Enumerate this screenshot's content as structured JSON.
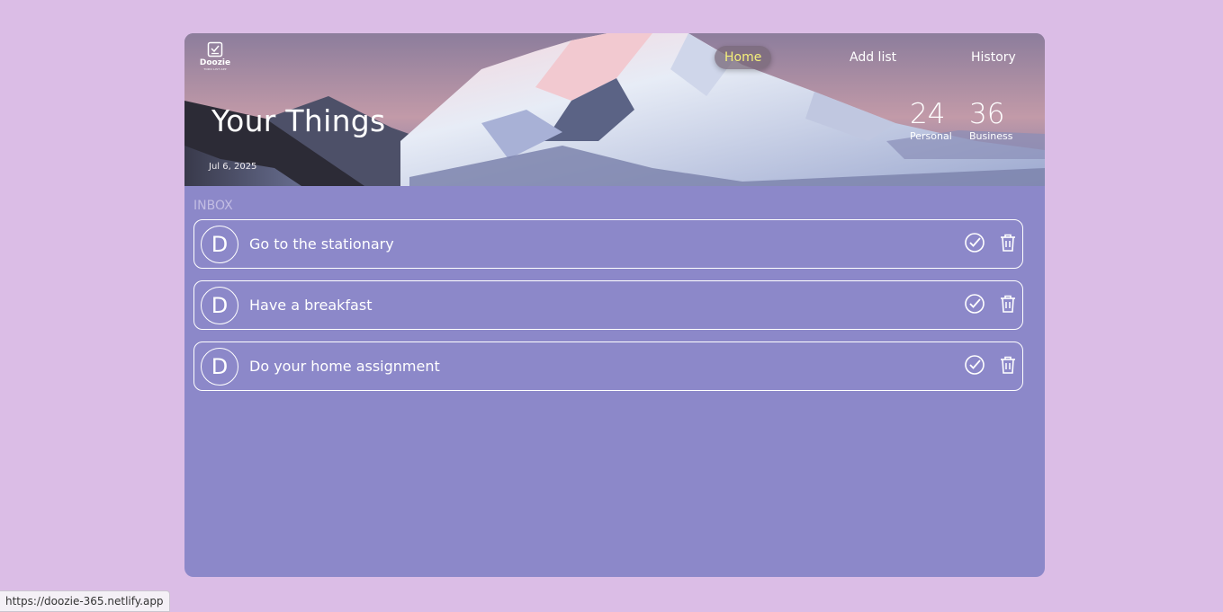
{
  "logo": {
    "name": "Doozie",
    "tagline": "TODO LIST APP"
  },
  "nav": {
    "items": [
      {
        "label": "Home",
        "active": true
      },
      {
        "label": "Add list",
        "active": false
      },
      {
        "label": "History",
        "active": false
      }
    ]
  },
  "hero": {
    "title": "Your Things",
    "date": "Jul 6, 2025"
  },
  "stats": [
    {
      "value": "24",
      "label": "Personal"
    },
    {
      "value": "36",
      "label": "Business"
    }
  ],
  "inbox": {
    "label": "INBOX",
    "tasks": [
      {
        "avatar": "D",
        "text": "Go to the stationary"
      },
      {
        "avatar": "D",
        "text": "Have a breakfast"
      },
      {
        "avatar": "D",
        "text": "Do your home assignment"
      }
    ]
  },
  "status_bar": {
    "url": "https://doozie-365.netlify.app"
  },
  "colors": {
    "page_background": "#dbbde6",
    "card_background": "#8c88c9",
    "active_nav_text": "#f4f07a"
  },
  "icons": {
    "logo": "clipboard-check-icon",
    "complete": "check-circle-icon",
    "delete": "trash-icon"
  }
}
